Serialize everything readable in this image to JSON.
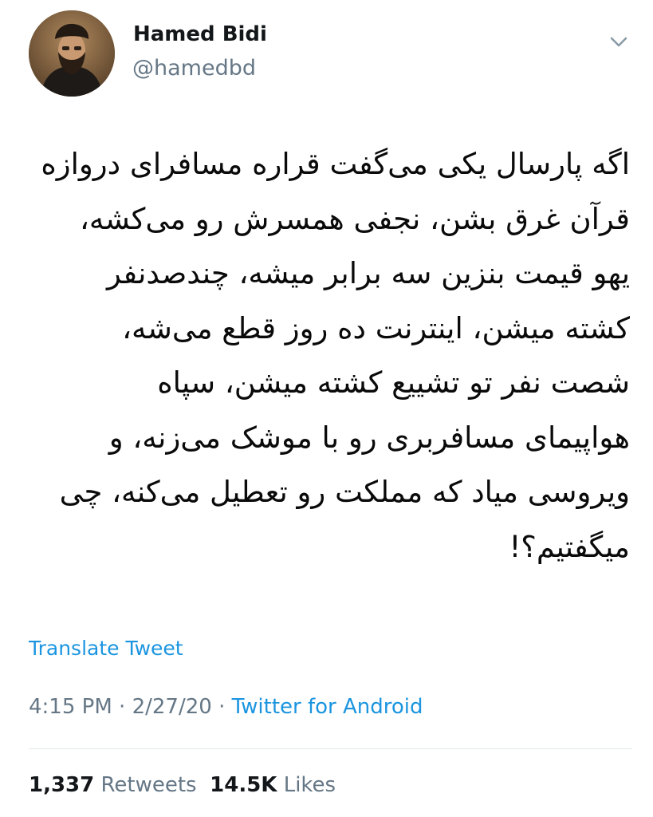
{
  "author": {
    "name": "Hamed Bidi",
    "handle": "@hamedbd",
    "avatar_icon": "user-avatar-photo"
  },
  "tweet": {
    "lines": [
      "اگه پارسال یکی می‌گفت قراره مسافرای دروازه",
      "قرآن غرق بشن، نجفی همسرش رو می‌کشه،",
      "یهو قیمت بنزین سه برابر میشه، چندصدنفر",
      "کشته میشن، اینترنت ده روز قطع می‌شه،",
      "شصت نفر تو تشییع کشته میشن، سپاه",
      "هواپیمای مسافربری رو با موشک می‌زنه، و",
      "ویروسی میاد که مملکت رو تعطیل می‌کنه، چی",
      "میگفتیم؟!"
    ],
    "translate_label": "Translate Tweet",
    "time": "4:15 PM",
    "date": "2/27/20",
    "separator": "·",
    "source": "Twitter for Android"
  },
  "stats": {
    "retweets_count": "1,337",
    "retweets_label": "Retweets",
    "likes_count": "14.5K",
    "likes_label": "Likes"
  },
  "colors": {
    "link": "#1b95e0",
    "secondary_text": "#657786",
    "primary_text": "#14171a",
    "divider": "#e1e8ed"
  }
}
